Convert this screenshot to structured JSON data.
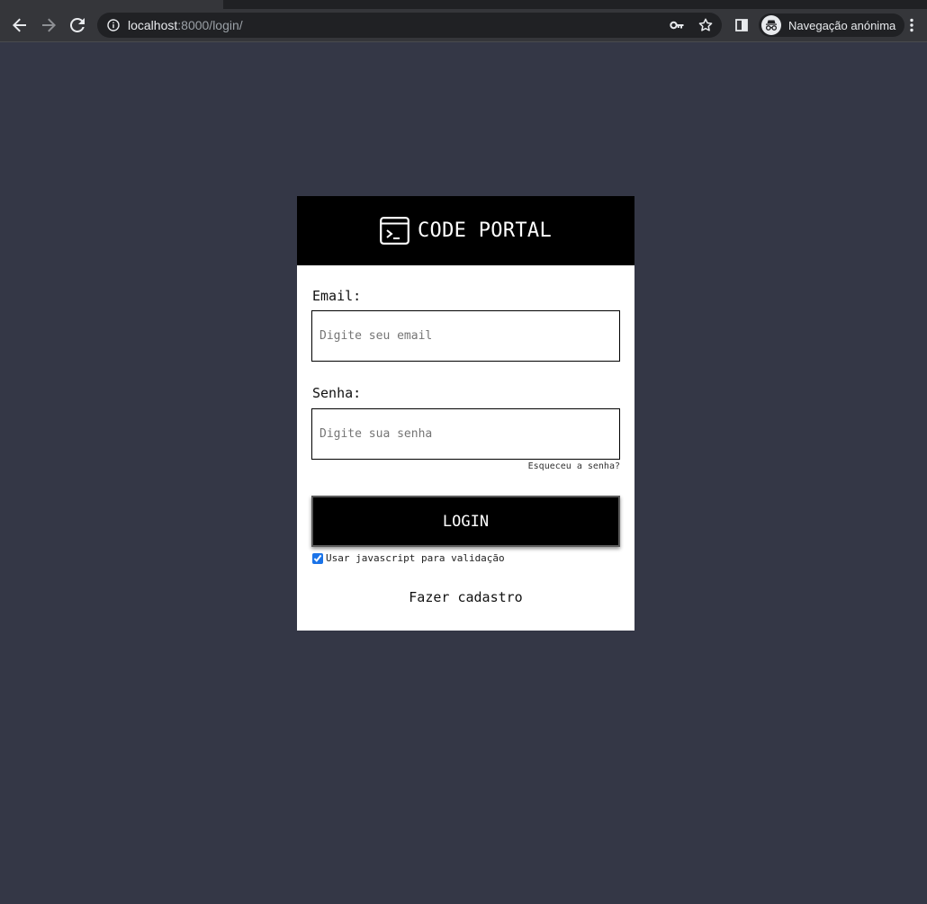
{
  "browser": {
    "url_host": "localhost",
    "url_path": ":8000/login/",
    "incognito_label": "Navegação anónima",
    "icons": {
      "back": "back-arrow-icon",
      "forward": "forward-arrow-icon",
      "reload": "reload-icon",
      "site_info": "info-icon",
      "passwords": "key-icon",
      "bookmark": "star-icon",
      "side_panel": "side-panel-icon",
      "incognito": "incognito-icon",
      "menu": "kebab-menu-icon"
    }
  },
  "header": {
    "brand": "CODE PORTAL",
    "logo_icon": "terminal-icon"
  },
  "form": {
    "email_label": "Email:",
    "email_placeholder": "Digite seu email",
    "email_value": "",
    "password_label": "Senha:",
    "password_placeholder": "Digite sua senha",
    "password_value": "",
    "forgot_link": "Esqueceu a senha?",
    "submit_label": "LOGIN",
    "js_validation_label": "Usar javascript para validação",
    "js_validation_checked": true,
    "signup_link": "Fazer cadastro"
  },
  "colors": {
    "page_background": "#343746",
    "card_background": "#ffffff",
    "header_background": "#000000",
    "button_background": "#000000",
    "accent": "#1a73e8"
  }
}
